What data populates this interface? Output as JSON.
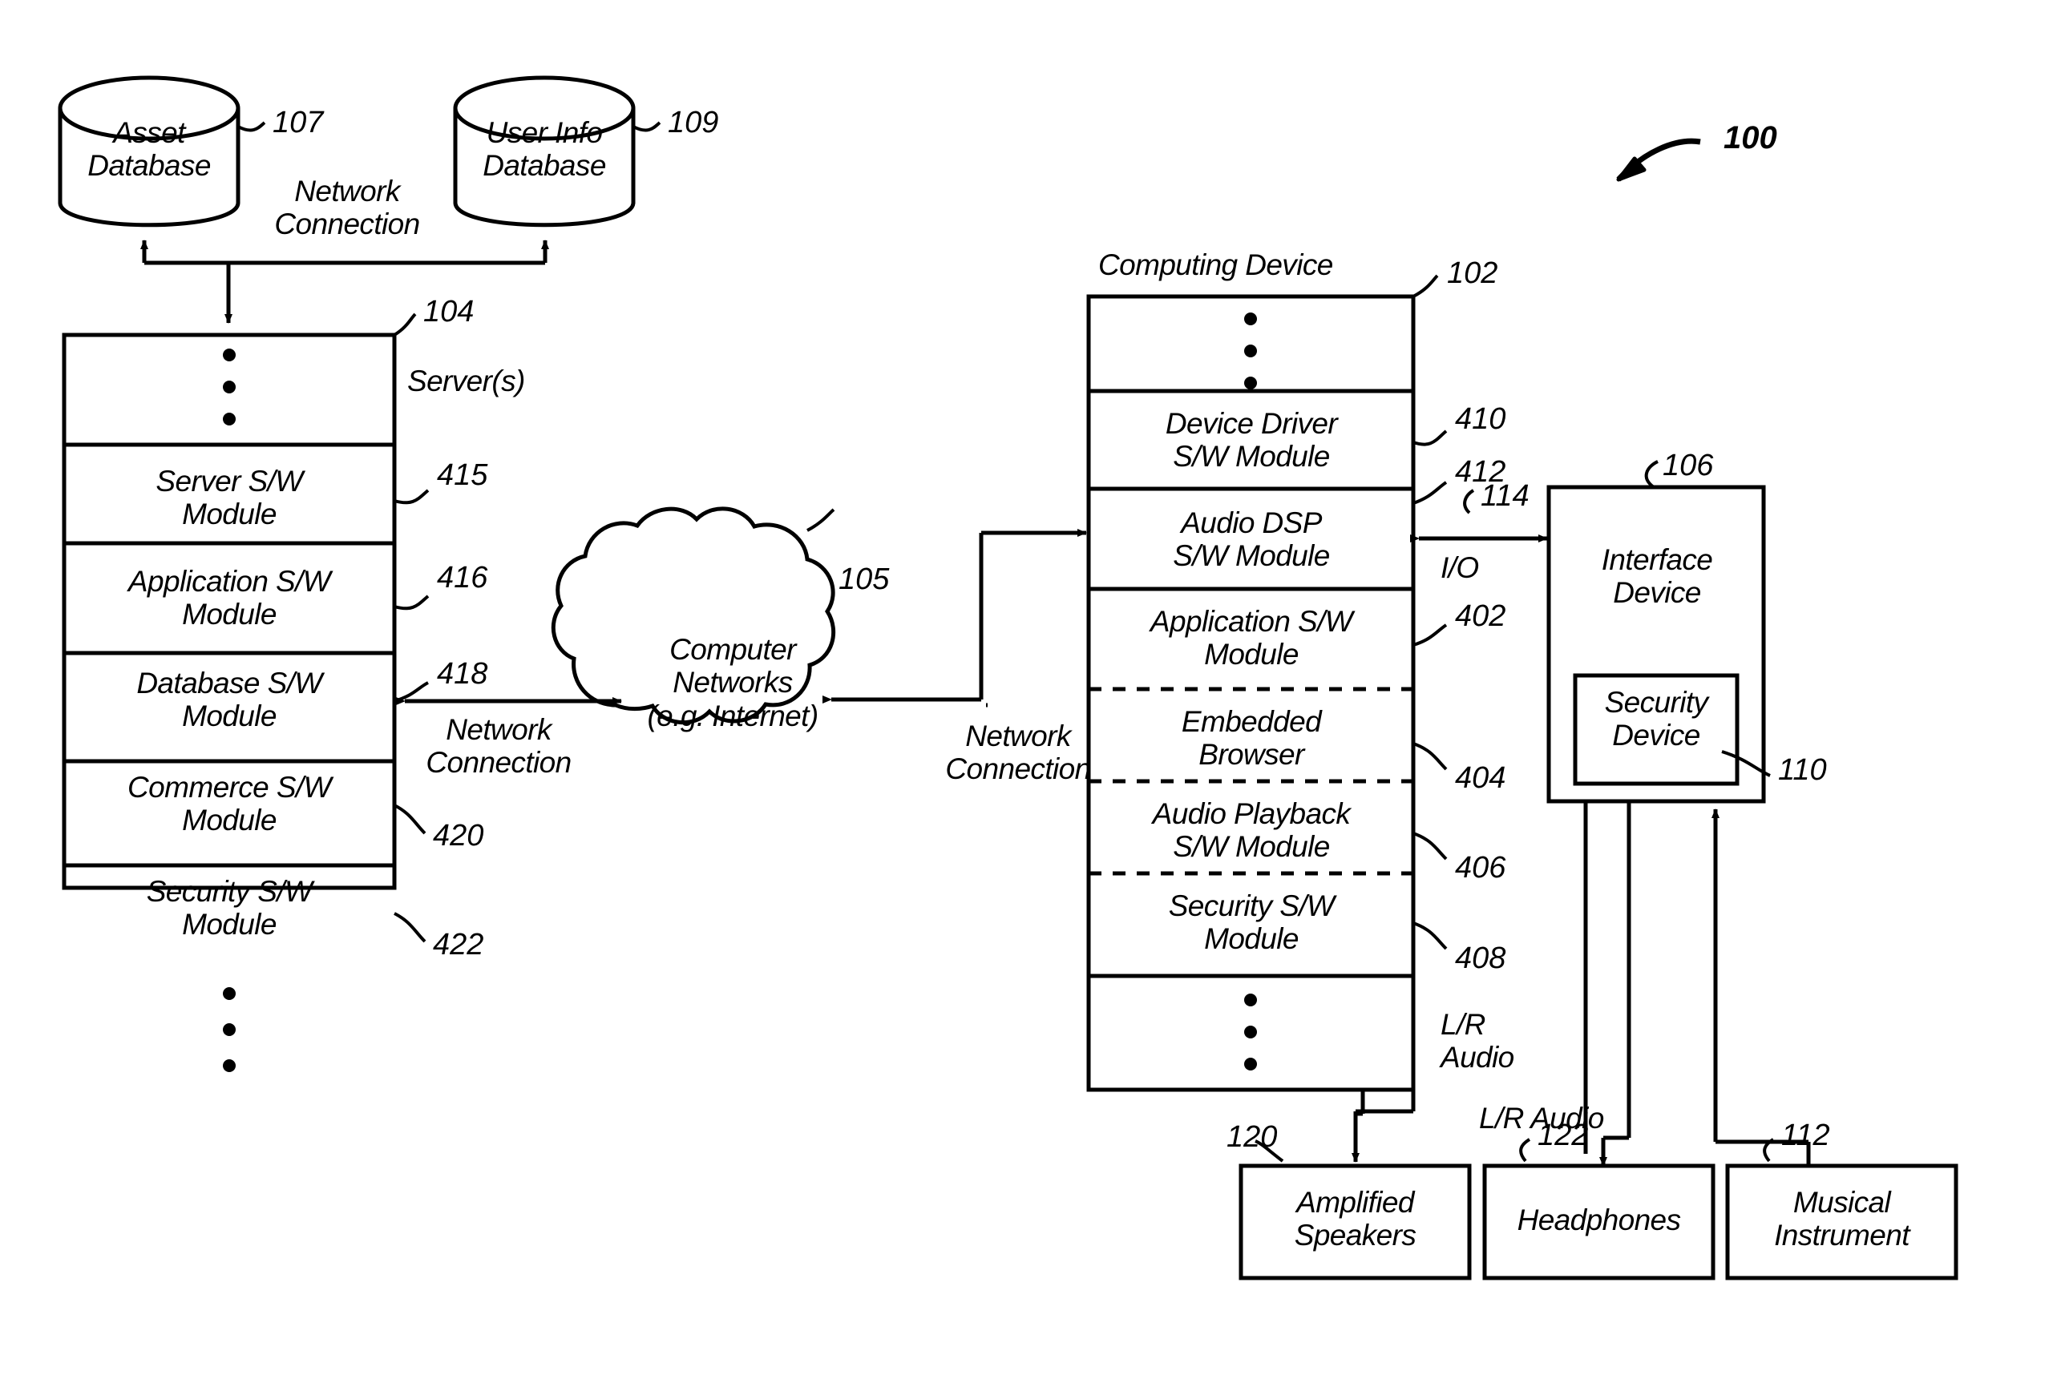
{
  "figure": {
    "number": "100"
  },
  "databases": [
    {
      "id": "asset-database",
      "label": "Asset\nDatabase",
      "ref": "107"
    },
    {
      "id": "user-info-database",
      "label": "User Info\nDatabase",
      "ref": "109"
    }
  ],
  "connection_labels": {
    "db_network": "Network\nConnection",
    "server_network": "Network\nConnection",
    "device_network": "Network\nConnection",
    "io": "I/O",
    "io_ref": "114",
    "lr_audio_vertical": "L/R\nAudio",
    "lr_audio_horizontal": "L/R Audio"
  },
  "server": {
    "title": "Server(s)",
    "ref": "104",
    "rows": [
      {
        "label": "•\n•\n•",
        "ref": "",
        "kind": "ellipsis"
      },
      {
        "label": "Server S/W\nModule",
        "ref": "415",
        "kind": "module"
      },
      {
        "label": "Application S/W\nModule",
        "ref": "416",
        "kind": "module"
      },
      {
        "label": "Database S/W\nModule",
        "ref": "418",
        "kind": "module"
      },
      {
        "label": "Commerce S/W\nModule",
        "ref": "420",
        "kind": "module"
      },
      {
        "label": "Security S/W\nModule",
        "ref": "422",
        "kind": "module"
      },
      {
        "label": "•\n•\n•",
        "ref": "",
        "kind": "ellipsis"
      }
    ]
  },
  "cloud": {
    "label": "Computer\nNetworks\n(e.g. Internet)",
    "ref": "105"
  },
  "computing_device": {
    "title": "Computing Device",
    "ref": "102",
    "rows": [
      {
        "label": "•\n•\n•",
        "ref": "",
        "kind": "ellipsis"
      },
      {
        "label": "Device Driver\nS/W Module",
        "ref": "410",
        "kind": "module"
      },
      {
        "label": "Audio DSP\nS/W Module",
        "ref": "412",
        "kind": "module"
      },
      {
        "label": "Application S/W\nModule",
        "ref": "402",
        "kind": "module"
      },
      {
        "label": "Embedded\nBrowser",
        "ref": "404",
        "kind": "module-dashed"
      },
      {
        "label": "Audio Playback\nS/W Module",
        "ref": "406",
        "kind": "module-dashed"
      },
      {
        "label": "Security S/W\nModule",
        "ref": "408",
        "kind": "module-dashed"
      },
      {
        "label": "•\n•\n•",
        "ref": "",
        "kind": "ellipsis"
      }
    ]
  },
  "interface_device": {
    "label": "Interface\nDevice",
    "ref": "106",
    "security_device": {
      "label": "Security\nDevice",
      "ref": "110"
    }
  },
  "output_devices": [
    {
      "id": "amplified-speakers",
      "label": "Amplified\nSpeakers",
      "ref": "120"
    },
    {
      "id": "headphones",
      "label": "Headphones",
      "ref": "122"
    },
    {
      "id": "musical-instrument",
      "label": "Musical\nInstrument",
      "ref": "112"
    }
  ],
  "colors": {
    "ink": "#000000",
    "paper": "#ffffff"
  }
}
